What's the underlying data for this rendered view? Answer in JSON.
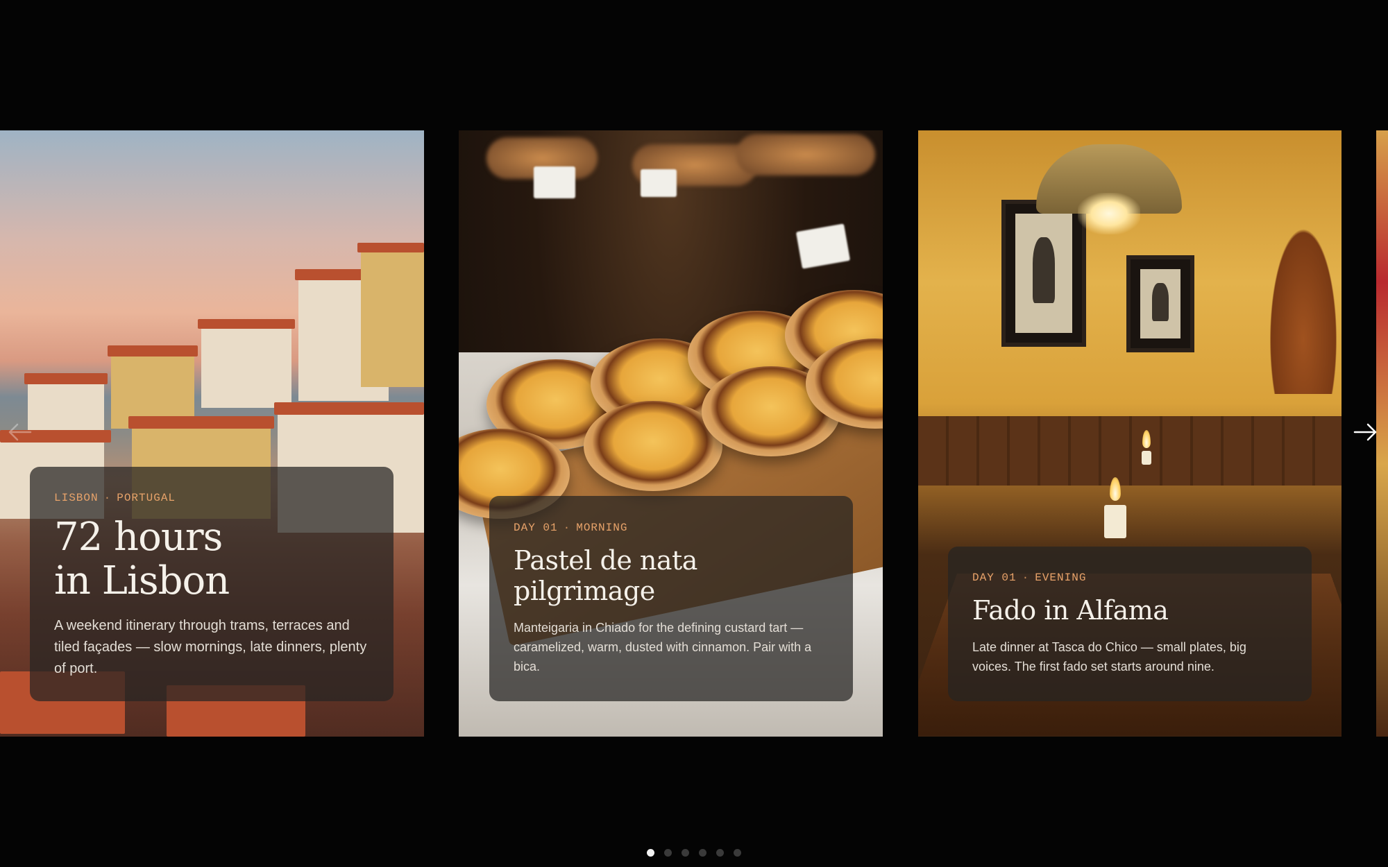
{
  "carousel": {
    "cards": [
      {
        "eyebrow_place": "LISBON",
        "eyebrow_separator": "·",
        "eyebrow_detail": "PORTUGAL",
        "title_line1": "72 hours",
        "title_line2": "in Lisbon",
        "description": "A weekend itinerary through trams, terraces and tiled façades — slow mornings, late dinners, plenty of port.",
        "image": "lisbon-rooftops-sunset"
      },
      {
        "eyebrow_place": "DAY 01",
        "eyebrow_separator": "·",
        "eyebrow_detail": "MORNING",
        "title_line1": "Pastel de nata",
        "title_line2": "pilgrimage",
        "description": "Manteigaria in Chiado for the defining custard tart — caramelized, warm, dusted with cinnamon. Pair with a bica.",
        "image": "pastel-de-nata-counter"
      },
      {
        "eyebrow_place": "DAY 01",
        "eyebrow_separator": "·",
        "eyebrow_detail": "EVENING",
        "title_line1": "Fado in Alfama",
        "description": "Late dinner at Tasca do Chico — small plates, big voices. The first fado set starts around nine.",
        "image": "fado-tavern-candlelight"
      }
    ],
    "nav": {
      "prev_icon": "arrow-left-icon",
      "next_icon": "arrow-right-icon"
    },
    "pagination": {
      "total": 6,
      "active_index": 0
    }
  },
  "colors": {
    "background": "#040404",
    "eyebrow_accent": "#e8a36a",
    "panel": "rgba(38,36,34,0.72)",
    "dot_active": "#f2f2f2",
    "dot_inactive": "#3a3a3a"
  }
}
